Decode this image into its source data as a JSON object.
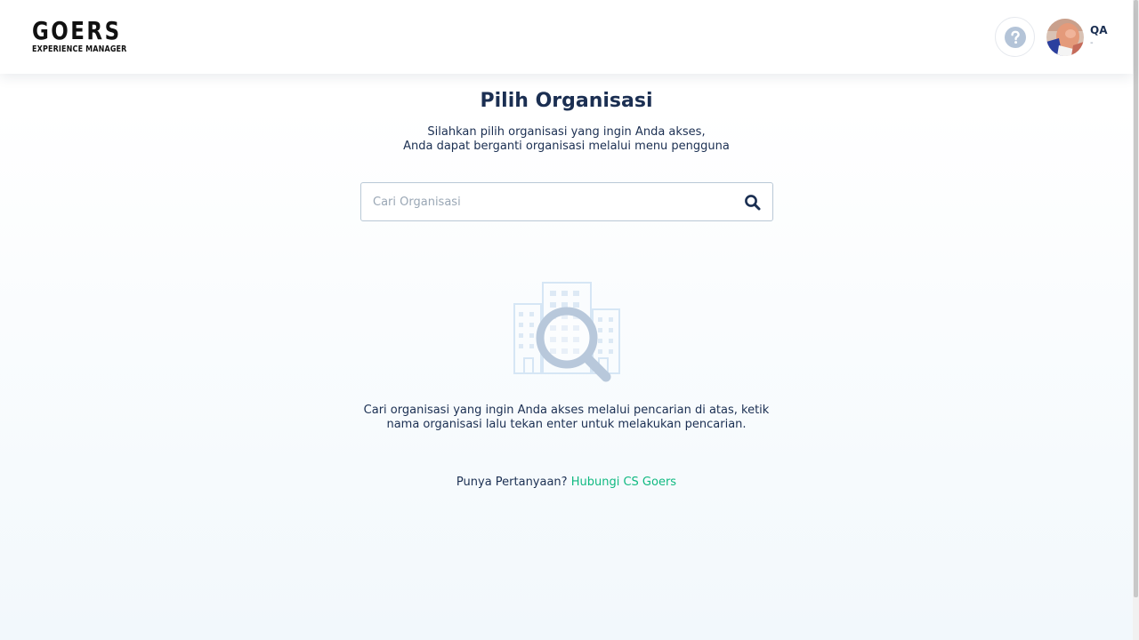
{
  "header": {
    "logo_main": "GOERS",
    "logo_sub": "EXPERIENCE MANAGER",
    "help_icon": "question-circle-icon",
    "user": {
      "name": "QA",
      "subtitle": "-"
    }
  },
  "main": {
    "title": "Pilih Organisasi",
    "subtitle_line1": "Silahkan pilih organisasi yang ingin Anda akses,",
    "subtitle_line2": "Anda dapat berganti organisasi melalui menu pengguna",
    "search": {
      "placeholder": "Cari Organisasi",
      "value": "",
      "icon": "search-icon"
    },
    "empty_state": {
      "icon": "building-search-illustration",
      "line1": "Cari organisasi yang ingin Anda akses melalui pencarian di atas, ketik",
      "line2": "nama organisasi lalu tekan enter untuk melakukan pencarian."
    },
    "contact": {
      "question": "Punya Pertanyaan?",
      "link_label": "Hubungi CS Goers"
    }
  },
  "colors": {
    "primary_text": "#1b2f52",
    "accent_link": "#10b981",
    "icon_muted": "#b4c4d8"
  }
}
